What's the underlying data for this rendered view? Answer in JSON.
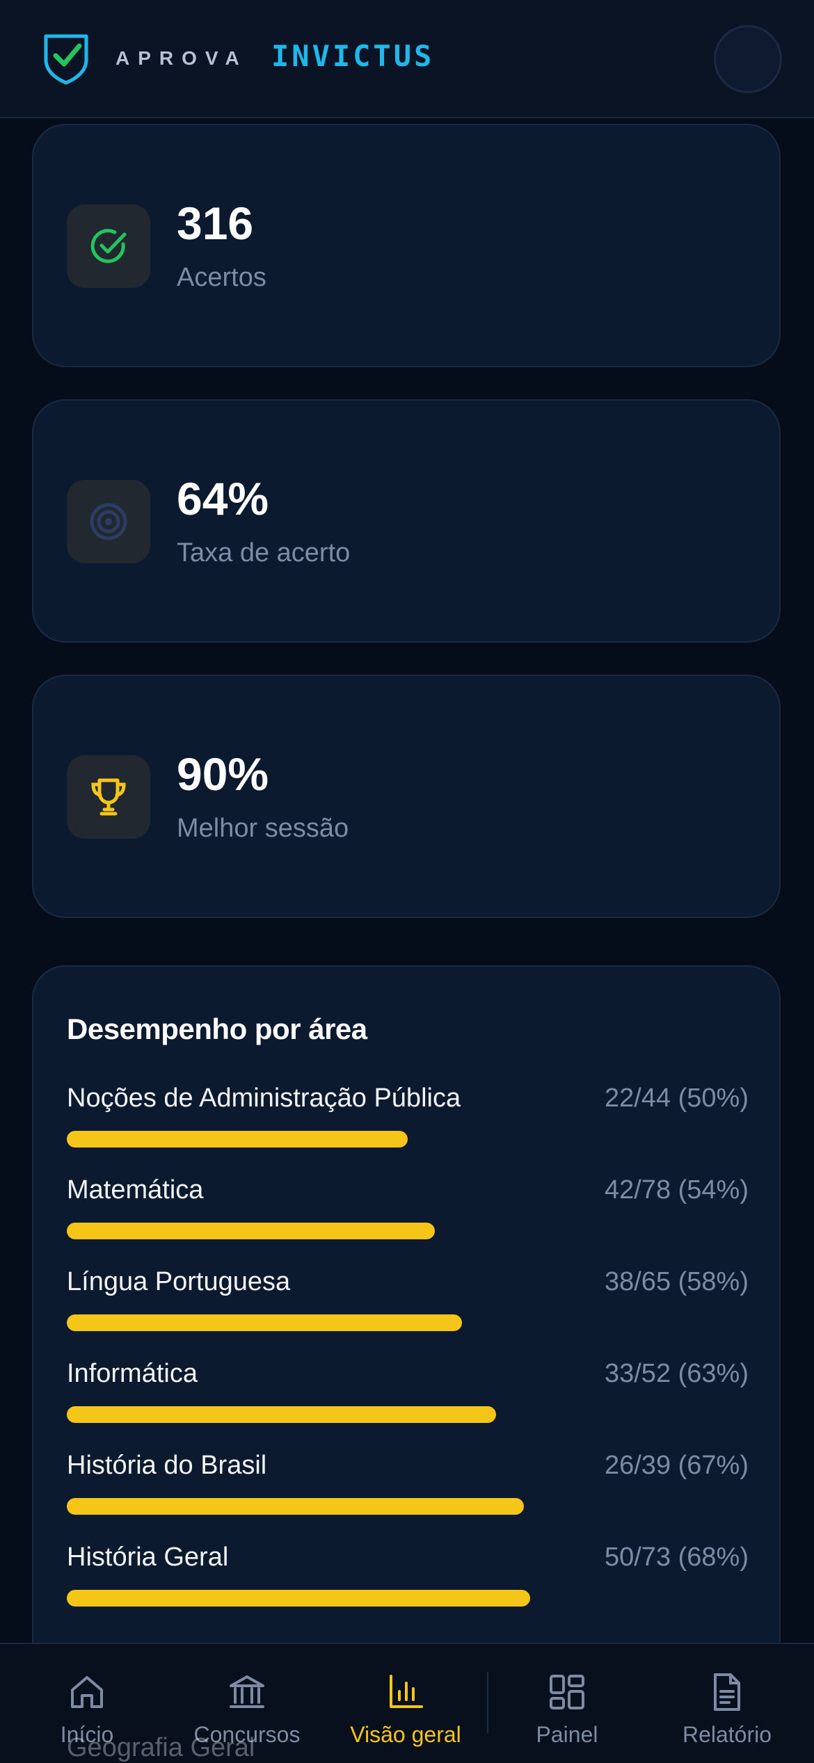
{
  "header": {
    "brand_prefix": "APROVA",
    "brand_name": "INVICTUS"
  },
  "stats": [
    {
      "value": "316",
      "label": "Acertos",
      "icon": "check-circle-icon",
      "icon_color": "#22c55e"
    },
    {
      "value": "64%",
      "label": "Taxa de acerto",
      "icon": "target-icon",
      "icon_color": "#2b3d63"
    },
    {
      "value": "90%",
      "label": "Melhor sessão",
      "icon": "trophy-icon",
      "icon_color": "#f5c518"
    }
  ],
  "performance": {
    "title": "Desempenho por área",
    "bar_color": "#f5c518",
    "items": [
      {
        "name": "Noções de Administração Pública",
        "stat": "22/44 (50%)",
        "percent": 50
      },
      {
        "name": "Matemática",
        "stat": "42/78 (54%)",
        "percent": 54
      },
      {
        "name": "Língua Portuguesa",
        "stat": "38/65 (58%)",
        "percent": 58
      },
      {
        "name": "Informática",
        "stat": "33/52 (63%)",
        "percent": 63
      },
      {
        "name": "História do Brasil",
        "stat": "26/39 (67%)",
        "percent": 67
      },
      {
        "name": "História Geral",
        "stat": "50/73 (68%)",
        "percent": 68
      }
    ],
    "partially_visible_next": "Geografia Geral"
  },
  "nav": {
    "items": [
      {
        "label": "Início",
        "icon": "home-icon"
      },
      {
        "label": "Concursos",
        "icon": "bank-icon"
      },
      {
        "label": "Visão geral",
        "icon": "bar-chart-icon",
        "active": true
      },
      {
        "label": "Painel",
        "icon": "grid-icon"
      },
      {
        "label": "Relatório",
        "icon": "document-icon"
      }
    ],
    "active_color": "#f5c518"
  },
  "colors": {
    "background": "#060d1a",
    "card": "#0c1a30",
    "accent_blue": "#20b8ea",
    "accent_yellow": "#f5c518",
    "success_green": "#22c55e",
    "muted_text": "#7d8ba4"
  }
}
